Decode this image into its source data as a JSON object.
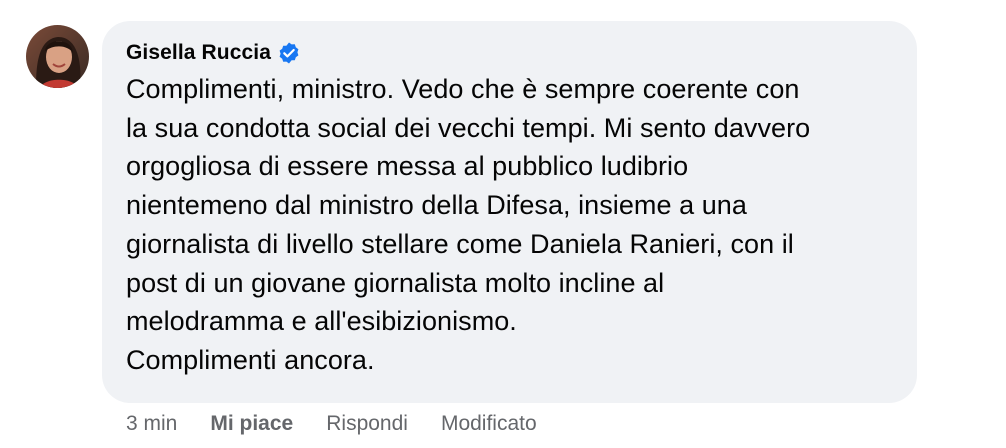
{
  "comment": {
    "author": "Gisella Ruccia",
    "verified_icon": "verified-badge-icon",
    "text": "Complimenti, ministro. Vedo che è sempre coerente con\nla sua condotta social dei vecchi tempi. Mi sento davvero\norgogliosa di essere messa al pubblico ludibrio\nnientemeno dal ministro della Difesa, insieme a una\ngiornalista di livello stellare come Daniela Ranieri, con il\npost di un giovane giornalista molto incline al\nmelodramma e all'esibizionismo.\nComplimenti ancora.",
    "bubble_color": "#f0f2f5",
    "verified_color": "#1877f2"
  },
  "actions": {
    "time": "3 min",
    "like": "Mi piace",
    "reply": "Rispondi",
    "edited": "Modificato",
    "color": "#65676b"
  }
}
